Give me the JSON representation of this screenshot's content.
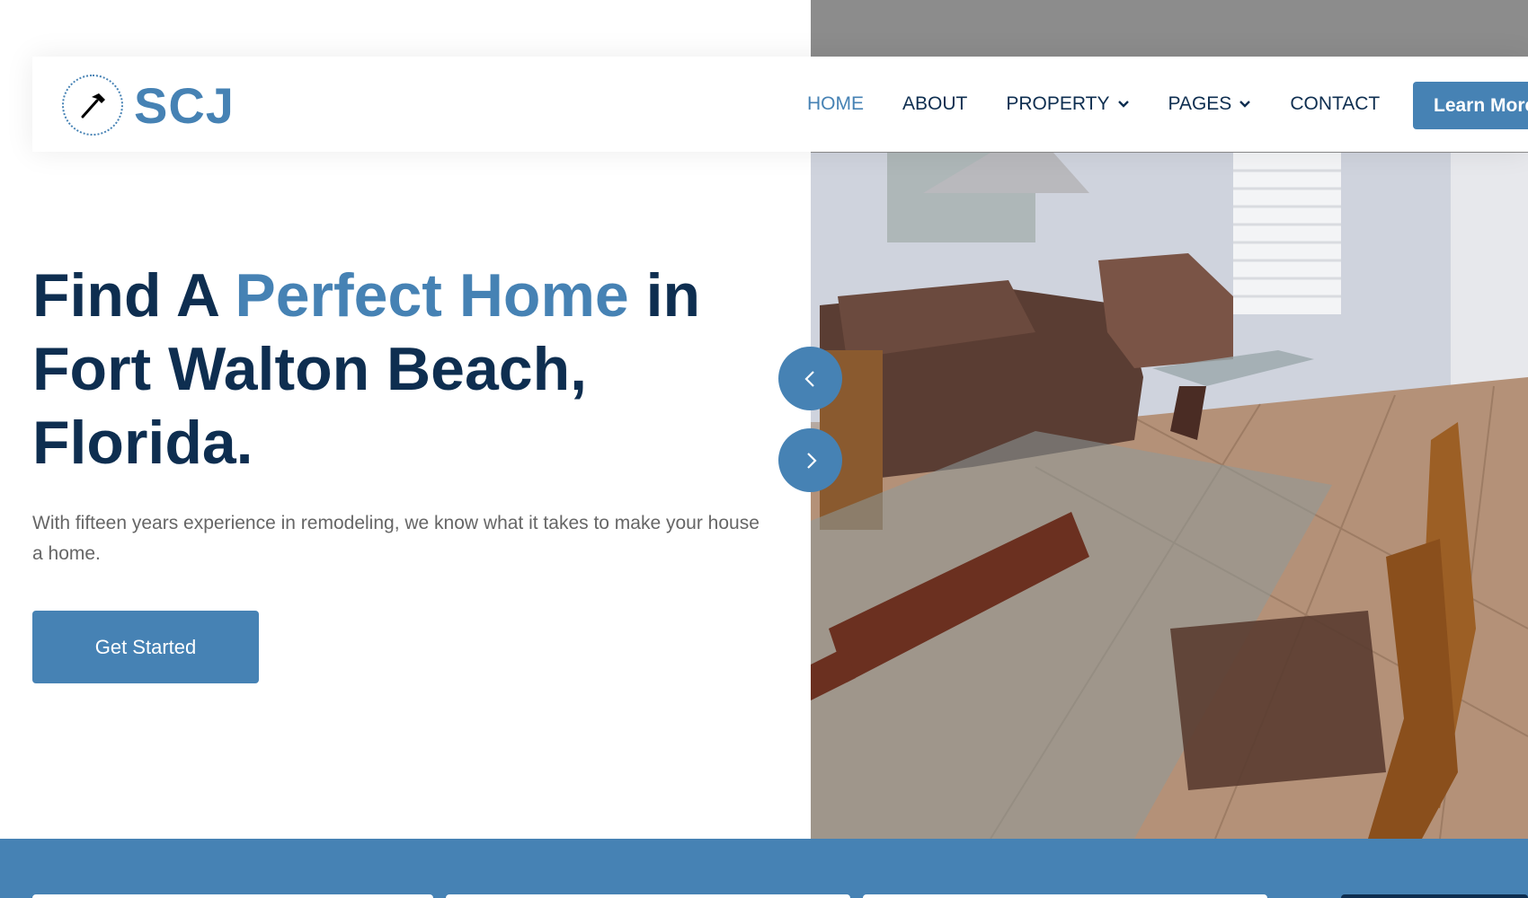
{
  "brand": {
    "name": "SCJ",
    "icon": "hammer-icon"
  },
  "nav": {
    "items": [
      {
        "label": "HOME",
        "active": true
      },
      {
        "label": "ABOUT"
      },
      {
        "label": "PROPERTY",
        "dropdown": true
      },
      {
        "label": "PAGES",
        "dropdown": true
      },
      {
        "label": "CONTACT"
      }
    ],
    "cta_label": "Learn More"
  },
  "hero": {
    "title_part1": "Find A ",
    "title_accent": "Perfect Home",
    "title_part2": " in Fort Walton Beach, Florida.",
    "subtitle": "With fifteen years experience in remodeling, we know what it takes to make your house a home.",
    "cta_label": "Get Started",
    "image_alt": "Living room interior with brown sofa, glass tables and tiled floor"
  },
  "carousel": {
    "prev_icon": "chevron-left-icon",
    "next_icon": "chevron-right-icon"
  },
  "colors": {
    "primary": "#4682b4",
    "dark": "#0e2e50",
    "text_muted": "#666666"
  }
}
